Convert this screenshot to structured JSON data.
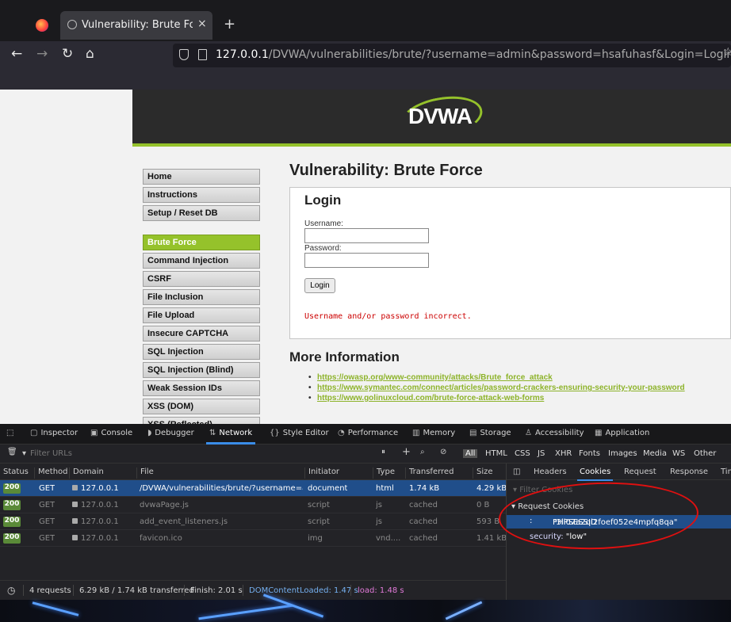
{
  "browser": {
    "tab_title": "Vulnerability: Brute Force",
    "tab_close": "×",
    "new_tab": "+",
    "url_host": "127.0.0.1",
    "url_rest": "/DVWA/vulnerabilities/brute/?username=admin&password=hsafuhasf&Login=Login#",
    "nav": {
      "back": "←",
      "forward": "→",
      "reload": "↻",
      "home": "⌂",
      "star": "☆"
    }
  },
  "dvwa": {
    "logo": "DVWA",
    "menu": [
      "Home",
      "Instructions",
      "Setup / Reset DB",
      "Brute Force",
      "Command Injection",
      "CSRF",
      "File Inclusion",
      "File Upload",
      "Insecure CAPTCHA",
      "SQL Injection",
      "SQL Injection (Blind)",
      "Weak Session IDs",
      "XSS (DOM)",
      "XSS (Reflected)"
    ],
    "active_menu": "Brute Force",
    "heading": "Vulnerability: Brute Force",
    "login": {
      "title": "Login",
      "username_label": "Username:",
      "password_label": "Password:",
      "button": "Login",
      "error": "Username and/or password incorrect."
    },
    "more_info_title": "More Information",
    "links": [
      "https://owasp.org/www-community/attacks/Brute_force_attack",
      "https://www.symantec.com/connect/articles/password-crackers-ensuring-security-your-password",
      "https://www.golinuxcloud.com/brute-force-attack-web-forms"
    ]
  },
  "devtools": {
    "tabs": [
      "Inspector",
      "Console",
      "Debugger",
      "Network",
      "Style Editor",
      "Performance",
      "Memory",
      "Storage",
      "Accessibility",
      "Application"
    ],
    "active_tab": "Network",
    "filter_placeholder": "Filter URLs",
    "pause": "⏸",
    "type_filters": [
      "All",
      "HTML",
      "CSS",
      "JS",
      "XHR",
      "Fonts",
      "Images",
      "Media",
      "WS",
      "Other"
    ],
    "columns": [
      "Status",
      "Method",
      "Domain",
      "File",
      "Initiator",
      "Type",
      "Transferred",
      "Size"
    ],
    "requests": [
      {
        "status": "200",
        "method": "GET",
        "domain": "127.0.0.1",
        "file": "/DVWA/vulnerabilities/brute/?username=admin&",
        "initiator": "document",
        "type": "html",
        "transferred": "1.74 kB",
        "size": "4.29 kB"
      },
      {
        "status": "200",
        "method": "GET",
        "domain": "127.0.0.1",
        "file": "dvwaPage.js",
        "initiator": "script",
        "type": "js",
        "transferred": "cached",
        "size": "0 B"
      },
      {
        "status": "200",
        "method": "GET",
        "domain": "127.0.0.1",
        "file": "add_event_listeners.js",
        "initiator": "script",
        "type": "js",
        "transferred": "cached",
        "size": "593 B"
      },
      {
        "status": "200",
        "method": "GET",
        "domain": "127.0.0.1",
        "file": "favicon.ico",
        "initiator": "img",
        "type": "vnd....",
        "transferred": "cached",
        "size": "1.41 kB"
      }
    ],
    "side_tabs": [
      "Headers",
      "Cookies",
      "Request",
      "Response",
      "Timings"
    ],
    "side_active": "Cookies",
    "filter_cookies": "Filter Cookies",
    "request_cookies_label": "Request Cookies",
    "cookies": [
      {
        "name": "PHPSESSID",
        "value": "\"3li07a2ql2foef052e4mpfq8qa\""
      },
      {
        "name": "security",
        "value": "\"low\""
      }
    ],
    "statusbar": {
      "requests": "4 requests",
      "size": "6.29 kB / 1.74 kB transferred",
      "finish": "Finish: 2.01 s",
      "dcl": "DOMContentLoaded: 1.47 s",
      "load": "load: 1.48 s"
    }
  },
  "colors": {
    "accent": "#95c22b",
    "selected_row": "#204e8a",
    "error": "#cc0000",
    "annotation": "#e01010"
  }
}
